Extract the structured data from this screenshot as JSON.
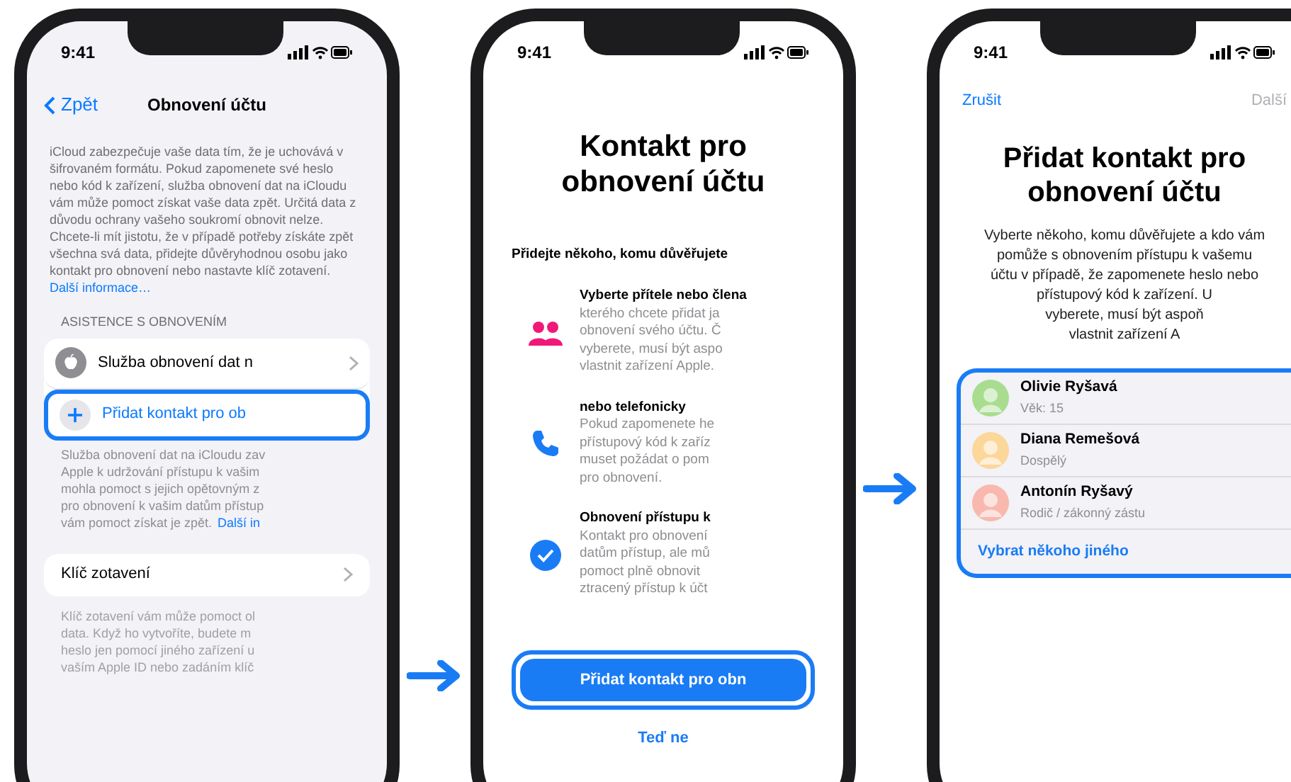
{
  "screens": [
    {
      "kind": "settings",
      "time": "9:41",
      "back": "Zpět",
      "title": "Obnovení účtu",
      "intro": "iCloud zabezpečuje vaše data tím, že je uchovává v šifrovaném formátu. Pokud zapomenete své heslo nebo kód k zařízení, služba obnovení dat na iCloudu vám může pomoct získat vaše data zpět. Určitá data z důvodu ochrany vašeho soukromí obnovit nelze. Chcete-li mít jistotu, že v případě potřeby získáte zpět všechna svá data, přidejte důvěryhodnou osobu jako kontakt pro obnovení nebo nastavte klíč zotavení.",
      "intro_link": "Další informace…",
      "section_header": "ASISTENCE S OBNOVENÍM",
      "rows": [
        {
          "kind": "service",
          "label": "Služba obnovení dat n",
          "highlighted": false
        },
        {
          "kind": "add",
          "label": "Přidat kontakt pro ob",
          "highlighted": true
        }
      ],
      "rows_footer_lines": [
        "Služba obnovení dat na iCloudu zav",
        "Apple k udržování přístupu k vašim",
        "mohla pomoct s jejich opětovným z",
        "pro obnovení k vašim datům přístup"
      ],
      "rows_footer_last": "vám pomoct získat je zpět.",
      "rows_footer_link": "Další in",
      "key_row": "Klíč zotavení",
      "key_footer_lines": [
        "Klíč zotavení vám může pomoct ol",
        "data. Když ho vytvoříte, budete m",
        "heslo jen pomocí jiného zařízení u",
        "vaším Apple ID nebo zadáním klíč"
      ]
    },
    {
      "kind": "intro",
      "time": "9:41",
      "title": "Kontakt pro obnovení účtu",
      "subtitle": "Přidejte někoho, komu důvěřujete",
      "features": [
        {
          "kind": "people",
          "title": "Vyberte přítele nebo člena",
          "lines": [
            "kterého chcete přidat ja",
            "obnovení svého účtu. Č",
            "vyberete, musí být aspo",
            "vlastnit zařízení Apple."
          ]
        },
        {
          "kind": "phone",
          "title": "nebo telefonicky",
          "lines": [
            "Pokud zapomenete he",
            "přístupový kód k zaříz",
            "muset požádat o pom",
            "pro obnovení."
          ]
        },
        {
          "kind": "check",
          "title": "Obnovení přístupu k",
          "lines": [
            "Kontakt pro obnovení",
            "datům přístup, ale mů",
            "pomoct plně obnovit",
            "ztracený přístup k účt"
          ]
        }
      ],
      "button": "Přidat kontakt pro obn",
      "link": "Teď ne"
    },
    {
      "kind": "picker",
      "time": "9:41",
      "cancel": "Zrušit",
      "next": "Další",
      "title": "Přidat kontakt pro obnovení účtu",
      "lines": [
        "Vyberte někoho, komu důvěřujete a kdo vám",
        "pomůže s obnovením přístupu k vašemu",
        "účtu v případě, že zapomenete heslo nebo",
        "přístupový kód k zařízení. U",
        "vyberete, musí být aspoň",
        "vlastnit zařízení A"
      ],
      "contacts": [
        {
          "name": "Olivie Ryšavá",
          "detail": "Věk: 15",
          "color": "#a8dd8f"
        },
        {
          "name": "Diana Remešová",
          "detail": "Dospělý",
          "color": "#fcd79a"
        },
        {
          "name": "Antonín Ryšavý",
          "detail": "Rodič / zákonný zástu",
          "color": "#f9b8ae"
        }
      ],
      "other": "Vybrat někoho jiného"
    }
  ]
}
